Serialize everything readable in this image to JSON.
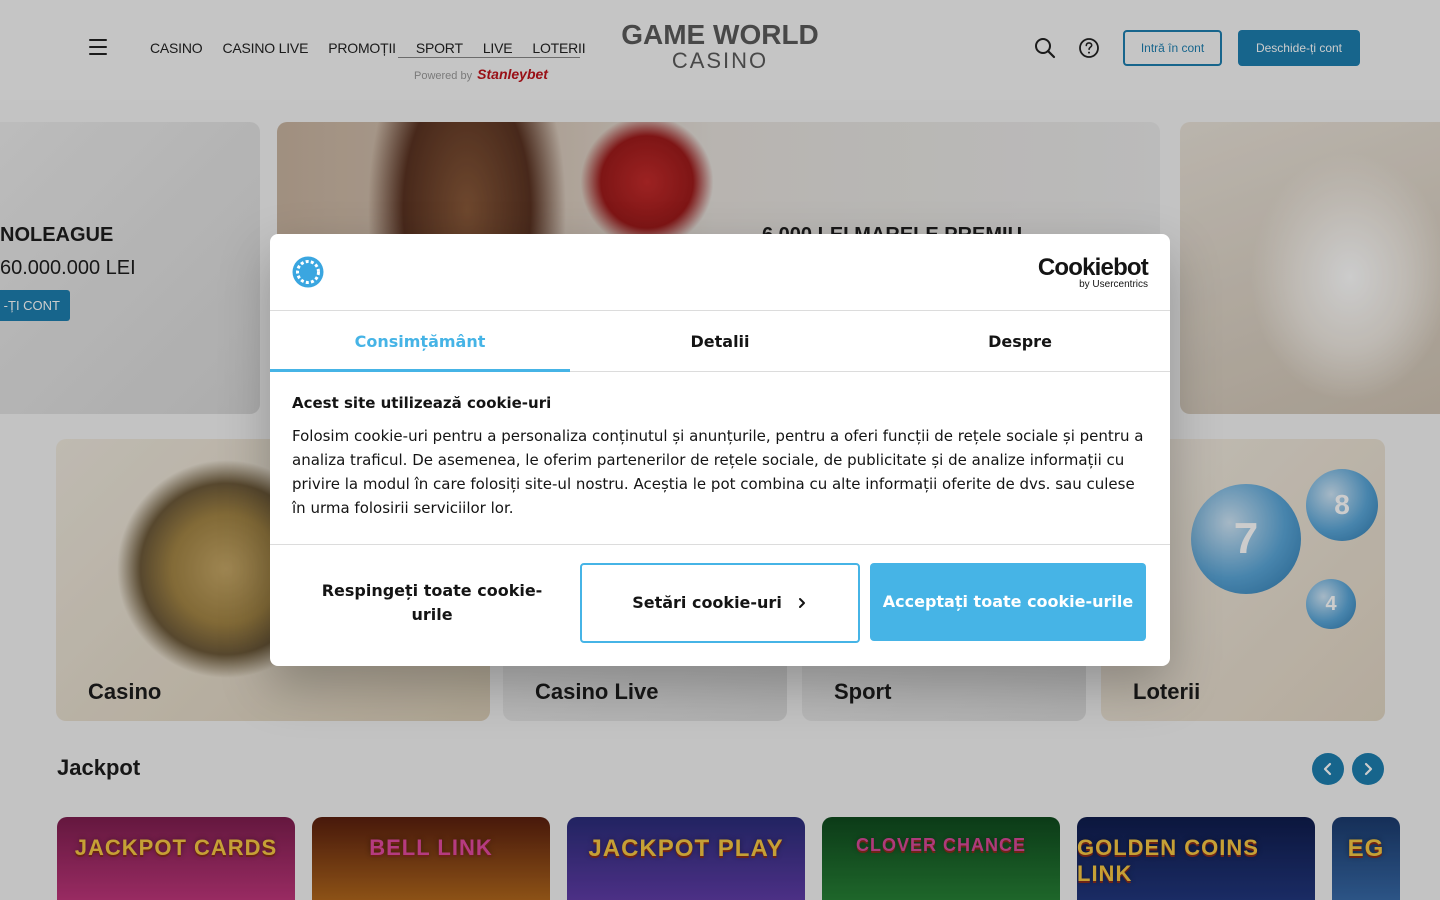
{
  "header": {
    "nav": [
      "CASINO",
      "CASINO LIVE",
      "PROMOȚII",
      "SPORT",
      "LIVE",
      "LOTERII"
    ],
    "powered_prefix": "Powered by",
    "powered_brand": "Stanleybet",
    "logo_line1": "GAME WORLD",
    "logo_line2": "CASINO",
    "login_label": "Intră în cont",
    "register_label": "Deschide-ți cont"
  },
  "banners": {
    "left_title": "NOLEAGUE",
    "left_amount": "60.000.000 LEI",
    "left_button": "-ȚI CONT",
    "center_title": "6.000 LEI MARELE PREMIU"
  },
  "categories": [
    "Casino",
    "Casino Live",
    "Sport",
    "Loterii"
  ],
  "jackpot": {
    "title": "Jackpot",
    "games": [
      "JACKPOT CARDS",
      "BELL LINK",
      "JACKPOT PLAY",
      "CLOVER CHANCE",
      "GOLDEN COINS LINK",
      "EG"
    ]
  },
  "cookie_dialog": {
    "brand": "Cookiebot",
    "brand_sub": "by Usercentrics",
    "tabs": [
      "Consimțământ",
      "Detalii",
      "Despre"
    ],
    "heading": "Acest site utilizează cookie-uri",
    "body": "Folosim cookie-uri pentru a personaliza conținutul și anunțurile, pentru a oferi funcții de rețele sociale și pentru a analiza traficul. De asemenea, le oferim partenerilor de rețele sociale, de publicitate și de analize informații cu privire la modul în care folosiți site-ul nostru. Aceștia le pot combina cu alte informații oferite de dvs. sau culese în urma folosirii serviciilor lor.",
    "deny_label": "Respingeți toate cookie-urile",
    "settings_label": "Setări cookie-uri",
    "accept_label": "Acceptați toate cookie-urile"
  },
  "colors": {
    "brand_blue": "#1d7fb0",
    "cookiebot_accent": "#46b4e6"
  }
}
